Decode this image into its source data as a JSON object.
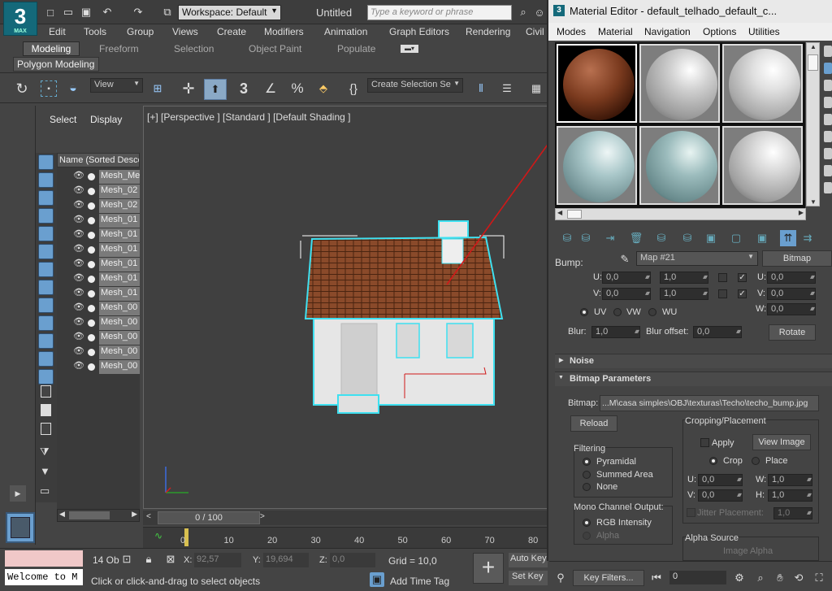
{
  "app": {
    "workspace": "Workspace: Default",
    "title": "Untitled",
    "search_placeholder": "Type a keyword or phrase",
    "logo": "3",
    "logo_sub": "MAX"
  },
  "menu": [
    "Edit",
    "Tools",
    "Group",
    "Views",
    "Create",
    "Modifiers",
    "Animation",
    "Graph Editors",
    "Rendering",
    "Civil"
  ],
  "ribbon_tabs": [
    "Modeling",
    "Freeform",
    "Selection",
    "Object Paint",
    "Populate"
  ],
  "ribbon_sub": "Polygon Modeling",
  "toolbar": {
    "view_dropdown": "View",
    "selection_set": "Create Selection Se"
  },
  "scene_explorer": {
    "tabs": [
      "Select",
      "Display"
    ],
    "column": "Name (Sorted Desce",
    "items": [
      "Mesh_Me",
      "Mesh_02",
      "Mesh_02",
      "Mesh_01",
      "Mesh_01",
      "Mesh_01",
      "Mesh_01",
      "Mesh_01",
      "Mesh_01",
      "Mesh_00",
      "Mesh_00",
      "Mesh_00",
      "Mesh_00",
      "Mesh_00"
    ]
  },
  "viewport": {
    "label": "[+] [Perspective ] [Standard ] [Default Shading ]"
  },
  "timeline": {
    "frame": "0 / 100",
    "ticks": [
      "0",
      "10",
      "20",
      "30",
      "40",
      "50",
      "60",
      "70",
      "80"
    ]
  },
  "status": {
    "listener": "Welcome to M",
    "selected": "14 Ob",
    "x": "92,57",
    "y": "19,694",
    "z": "0,0",
    "x_label": "X:",
    "y_label": "Y:",
    "z_label": "Z:",
    "grid": "Grid = 10,0",
    "prompt": "Click or click-and-drag to select objects",
    "add_time_tag": "Add Time Tag",
    "auto_key": "Auto Key",
    "set_key": "Set Key",
    "key_filters": "Key Filters...",
    "frame_value": "0"
  },
  "material_editor": {
    "title": "Material Editor - default_telhado_default_c...",
    "menu": [
      "Modes",
      "Material",
      "Navigation",
      "Options",
      "Utilities"
    ],
    "bump_label": "Bump:",
    "map_name": "Map #21",
    "map_type": "Bitmap",
    "coords": {
      "u_left": "0,0",
      "v_left": "0,0",
      "u_tile": "1,0",
      "v_tile": "1,0",
      "w_u": "0,0",
      "w_v": "0,0",
      "w_w": "0,0",
      "u_label": "U:",
      "v_label": "V:",
      "w_label": "W:",
      "uv_options": [
        "UV",
        "VW",
        "WU"
      ],
      "blur_label": "Blur:",
      "blur": "1,0",
      "blur_offset_label": "Blur offset:",
      "blur_offset": "0,0",
      "rotate": "Rotate"
    },
    "rollouts": {
      "noise": "Noise",
      "bitmap_params": "Bitmap Parameters"
    },
    "bitmap_label": "Bitmap:",
    "bitmap_path": "...M\\casa simples\\OBJ\\texturas\\Techo\\techo_bump.jpg",
    "reload": "Reload",
    "filtering": {
      "title": "Filtering",
      "options": [
        "Pyramidal",
        "Summed Area",
        "None"
      ]
    },
    "mono": {
      "title": "Mono Channel Output:",
      "options": [
        "RGB Intensity",
        "Alpha"
      ]
    },
    "cropping": {
      "title": "Cropping/Placement",
      "apply": "Apply",
      "view_image": "View Image",
      "crop": "Crop",
      "place": "Place",
      "u": "0,0",
      "v": "0,0",
      "w": "1,0",
      "h": "1,0",
      "u_label": "U:",
      "v_label": "V:",
      "w_label": "W:",
      "h_label": "H:",
      "jitter_label": "Jitter Placement:",
      "jitter": "1,0"
    },
    "alpha_source": {
      "title": "Alpha Source",
      "option": "Image Alpha"
    }
  },
  "colors": {
    "accent": "#6a9fcf",
    "wire": "#3ee0f0",
    "roof": "#8a4a2a",
    "line": "#d01818"
  }
}
